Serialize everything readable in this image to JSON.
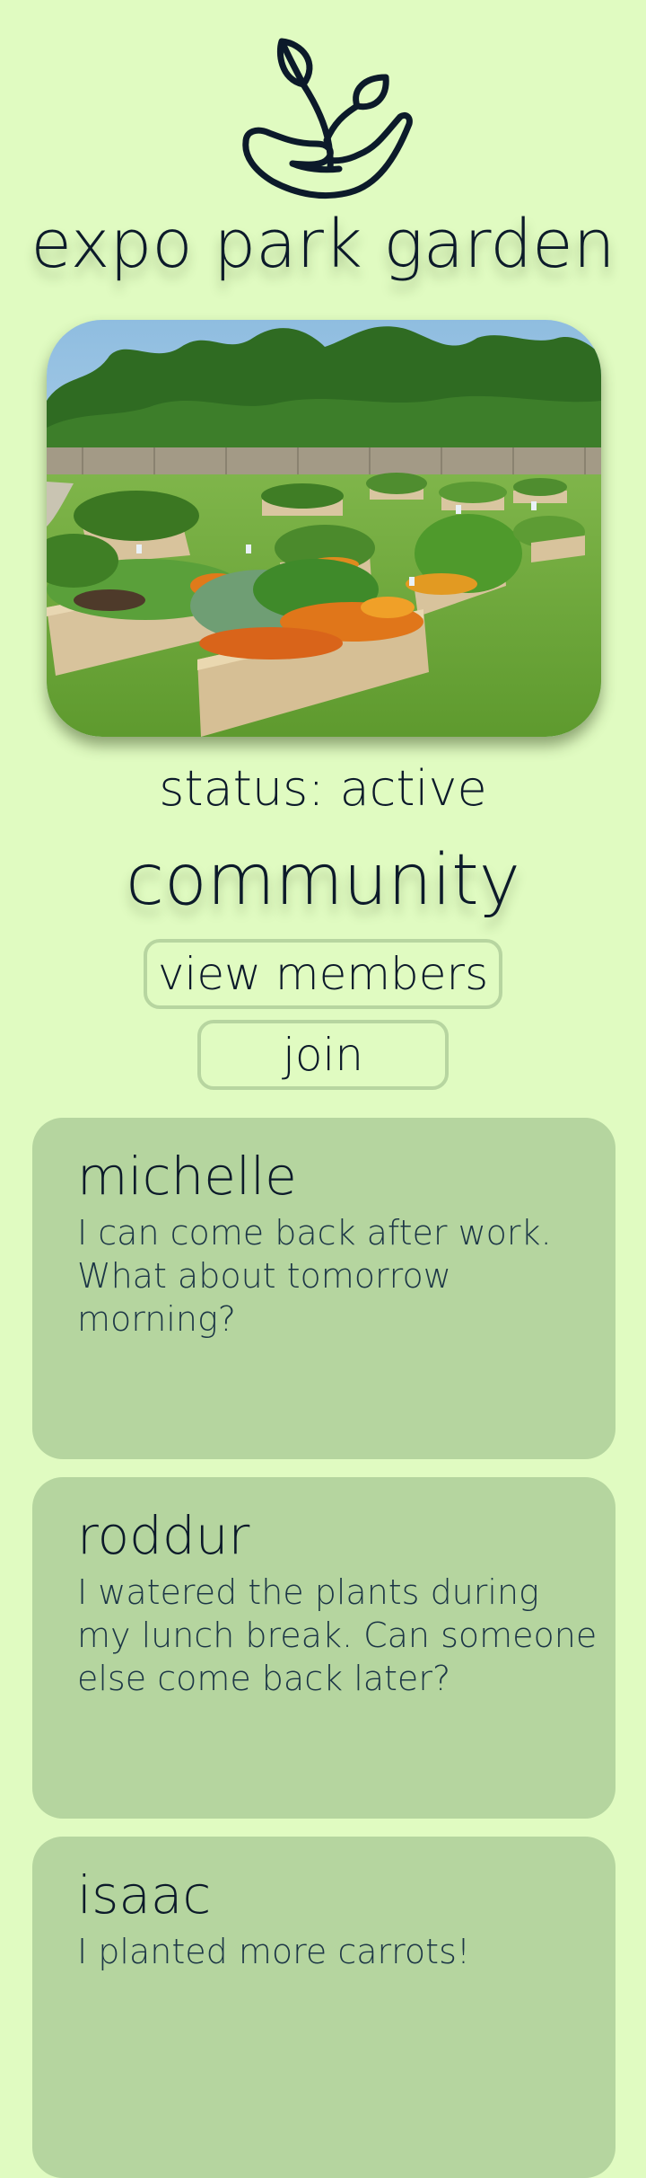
{
  "app": {
    "title": "expo park garden",
    "logo_icon": "plant-in-hand-icon"
  },
  "garden": {
    "photo_alt": "community-garden-photo",
    "status": "status: active"
  },
  "community": {
    "heading": "community",
    "view_members_label": "view members",
    "join_label": "join"
  },
  "messages": [
    {
      "author": "michelle",
      "text": "I can come back after work. What about tomorrow morning?"
    },
    {
      "author": "roddur",
      "text": "I watered the plants during my lunch break. Can someone else come back later?"
    },
    {
      "author": "isaac",
      "text": "I planted more carrots!"
    }
  ],
  "colors": {
    "background": "#e0fbc1",
    "card": "#b5d59f",
    "button_border": "#b7d5a0",
    "text": "#0c1a2a"
  }
}
